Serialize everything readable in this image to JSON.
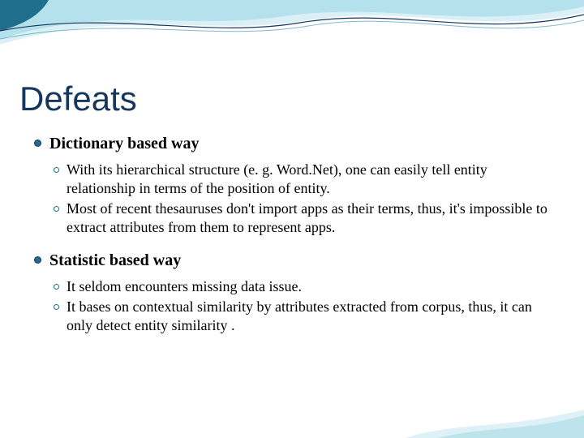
{
  "title": "Defeats",
  "sections": [
    {
      "heading": "Dictionary based way",
      "items": [
        "With its hierarchical structure (e. g. Word.Net), one can easily tell entity relationship in terms of the position of entity.",
        "Most of recent thesauruses don't import apps as their terms, thus, it's impossible to extract attributes from them to represent apps."
      ]
    },
    {
      "heading": "Statistic based way",
      "items": [
        "It seldom encounters missing data issue.",
        "It bases on contextual similarity by attributes extracted from corpus, thus, it can only detect entity similarity ."
      ]
    }
  ]
}
